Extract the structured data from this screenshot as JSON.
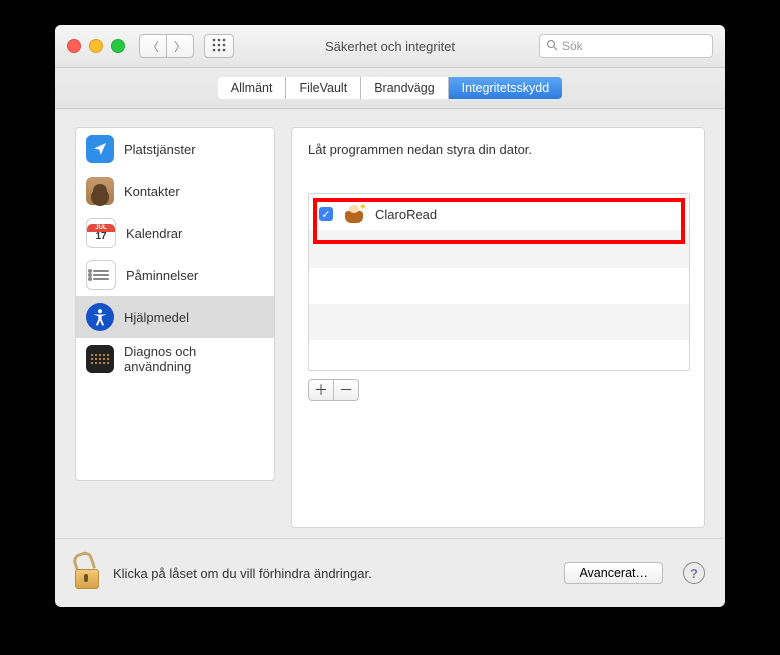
{
  "window": {
    "title": "Säkerhet och integritet"
  },
  "search": {
    "placeholder": "Sök"
  },
  "tabs": {
    "allmant": "Allmänt",
    "filevault": "FileVault",
    "brandvagg": "Brandvägg",
    "integritet": "Integritetsskydd"
  },
  "sidebar": {
    "items": [
      {
        "label": "Platstjänster"
      },
      {
        "label": "Kontakter"
      },
      {
        "label": "Kalendrar",
        "day": "17",
        "month": "JUL"
      },
      {
        "label": "Påminnelser"
      },
      {
        "label": "Hjälpmedel"
      },
      {
        "label": "Diagnos och användning"
      }
    ]
  },
  "main": {
    "instruction": "Låt programmen nedan styra din dator.",
    "apps": [
      {
        "name": "ClaroRead",
        "checked": true
      }
    ]
  },
  "footer": {
    "lock_text": "Klicka på låset om du vill förhindra ändringar.",
    "advanced": "Avancerat…"
  }
}
